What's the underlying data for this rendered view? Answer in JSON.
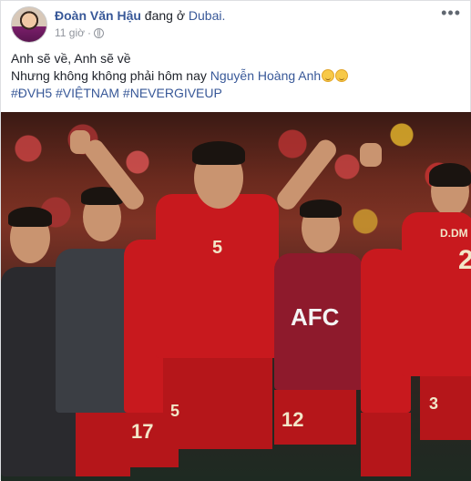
{
  "post": {
    "author": "Đoàn Văn Hậu",
    "location_prefix": "đang ở",
    "location": "Dubai.",
    "time": "11 giờ",
    "lines": {
      "line1": "Anh sẽ về, Anh sẽ về",
      "line2_text": "Nhưng không không phải hôm nay",
      "line2_mention": "Nguyễn Hoàng Anh",
      "hashtags": "#ĐVH5 #VIỆTNAM #NEVERGIVEUP"
    }
  },
  "photo": {
    "jersey_numbers": {
      "main": "5",
      "shorts_main": "5",
      "left_player": "17",
      "right_player": "12",
      "far_right_name": "D.DM",
      "far_right_number": "2",
      "right_back_shorts": "3"
    },
    "afc_text": "AFC"
  },
  "icons": {
    "more": "more-icon",
    "audience": "globe-icon"
  },
  "colors": {
    "link": "#385898",
    "jersey_red": "#c8191e"
  }
}
